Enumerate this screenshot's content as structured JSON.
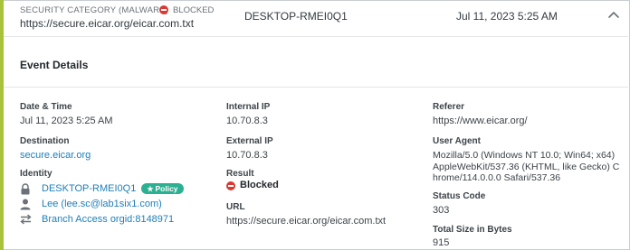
{
  "header": {
    "category_label": "SECURITY CATEGORY (MALWARE)",
    "blocked_label": "BLOCKED",
    "url": "https://secure.eicar.org/eicar.com.txt",
    "host": "DESKTOP-RMEI0Q1",
    "datetime": "Jul 11, 2023 5:25 AM"
  },
  "section": {
    "title": "Event Details"
  },
  "left": {
    "datetime_label": "Date & Time",
    "datetime_value": "Jul 11, 2023 5:25 AM",
    "destination_label": "Destination",
    "destination_value": "secure.eicar.org",
    "identity_label": "Identity",
    "identities": [
      {
        "icon": "lock-icon",
        "text": "DESKTOP-RMEI0Q1",
        "badge": "Policy"
      },
      {
        "icon": "user-icon",
        "text": "Lee (lee.sc@lab1six1.com)"
      },
      {
        "icon": "arrows-exchange-icon",
        "text": "Branch Access orgid:8148971"
      }
    ]
  },
  "middle": {
    "internal_ip_label": "Internal IP",
    "internal_ip_value": "10.70.8.3",
    "external_ip_label": "External IP",
    "external_ip_value": "10.70.8.3",
    "result_label": "Result",
    "result_value": "Blocked",
    "url_label": "URL",
    "url_value": "https://secure.eicar.org/eicar.com.txt"
  },
  "right": {
    "referer_label": "Referer",
    "referer_value": "https://www.eicar.org/",
    "user_agent_label": "User Agent",
    "user_agent_value": "Mozilla/5.0 (Windows NT 10.0; Win64; x64) AppleWebKit/537.36 (KHTML, like Gecko) Chrome/114.0.0.0 Safari/537.36",
    "status_code_label": "Status Code",
    "status_code_value": "303",
    "total_size_label": "Total Size in Bytes",
    "total_size_value": "915"
  },
  "colors": {
    "accent": "#a8c23a",
    "blocked": "#d63a32",
    "link": "#1e7fb8",
    "policy_badge": "#2bb191"
  }
}
